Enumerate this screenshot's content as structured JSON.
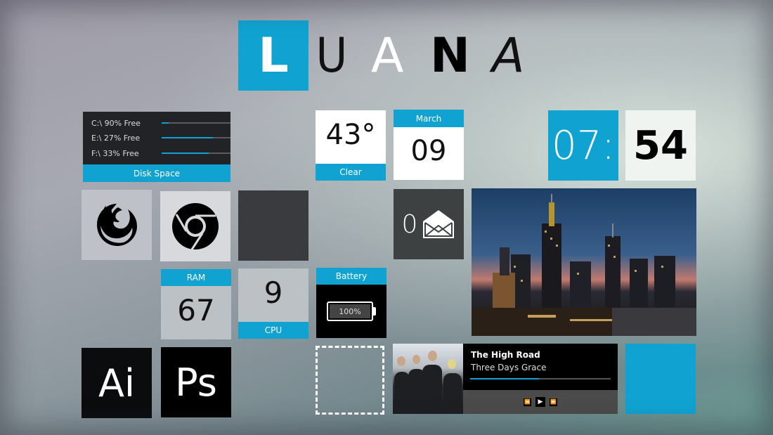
{
  "logo": {
    "letters": [
      "L",
      "U",
      "A",
      "N",
      "A"
    ]
  },
  "disk": {
    "title": "Disk Space",
    "drives": [
      {
        "label": "C:\\  90% Free",
        "used_fraction": 0.1
      },
      {
        "label": "E:\\  27% Free",
        "used_fraction": 0.73
      },
      {
        "label": "F:\\  33% Free",
        "used_fraction": 0.67
      }
    ]
  },
  "weather": {
    "temperature": "43°",
    "condition": "Clear"
  },
  "date": {
    "month": "March",
    "day": "09"
  },
  "clock": {
    "hours": "07:",
    "minutes": "54"
  },
  "apps": {
    "firefox": "firefox-icon",
    "chrome": "chrome-icon",
    "ai": "Ai",
    "ps": "Ps"
  },
  "mail": {
    "count": "0"
  },
  "ram": {
    "label": "RAM",
    "value": "67"
  },
  "cpu": {
    "label": "CPU",
    "value": "9"
  },
  "battery": {
    "label": "Battery",
    "percent": "100%"
  },
  "music": {
    "title": "The High Road",
    "artist": "Three Days Grace",
    "progress_fraction": 0.49,
    "controls": {
      "prev": "⏪",
      "play": "▶",
      "next": "⏩"
    }
  },
  "colors": {
    "accent": "#10a3d2"
  }
}
